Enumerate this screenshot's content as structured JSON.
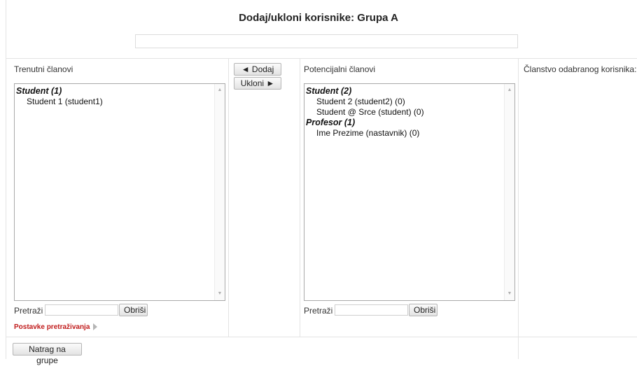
{
  "page": {
    "title": "Dodaj/ukloni korisnike: Grupa A",
    "description_value": ""
  },
  "current": {
    "label": "Trenutni članovi",
    "groups": [
      {
        "name": "Student (1)",
        "options": [
          "Student 1 (student1)"
        ]
      }
    ],
    "search_label": "Pretraži",
    "search_value": "",
    "clear_label": "Obriši",
    "settings_link": "Postavke pretraživanja"
  },
  "actions": {
    "add_label": "◄ Dodaj",
    "remove_label": "Ukloni ►"
  },
  "potential": {
    "label": "Potencijalni članovi",
    "groups": [
      {
        "name": "Student (2)",
        "options": [
          "Student 2 (student2) (0)",
          "Student @ Srce (student) (0)"
        ]
      },
      {
        "name": "Profesor (1)",
        "options": [
          "Ime Prezime (nastavnik) (0)"
        ]
      }
    ],
    "search_label": "Pretraži",
    "search_value": "",
    "clear_label": "Obriši"
  },
  "membership": {
    "label": "Članstvo odabranog korisnika:"
  },
  "footer": {
    "back_label": "Natrag na grupe"
  }
}
